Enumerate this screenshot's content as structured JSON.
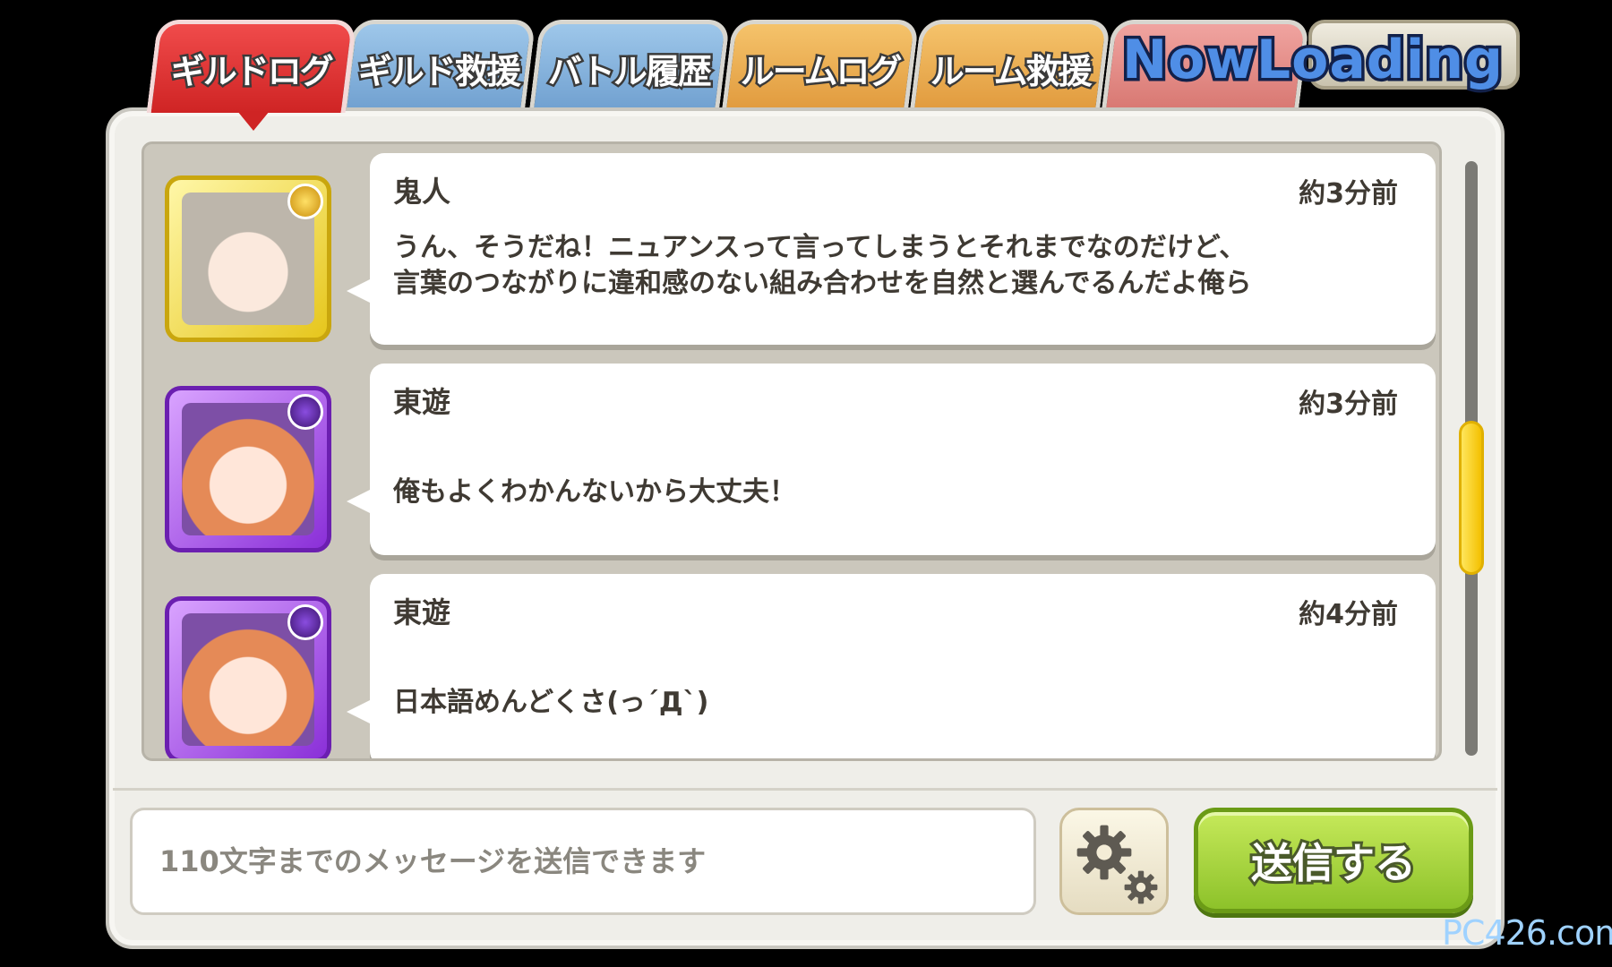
{
  "tabs": [
    {
      "label": "ギルドログ",
      "active": true,
      "color": "#e03535"
    },
    {
      "label": "ギルド救援",
      "active": false,
      "color": "#86b3de"
    },
    {
      "label": "バトル履歴",
      "active": false,
      "color": "#86b3de"
    },
    {
      "label": "ルームログ",
      "active": false,
      "color": "#efae55"
    },
    {
      "label": "ルーム救援",
      "active": false,
      "color": "#efae55"
    },
    {
      "label": "",
      "active": false,
      "color": "#e48f88"
    }
  ],
  "loading_text": "NowLoading",
  "messages": [
    {
      "name": "鬼人",
      "time": "約3分前",
      "text": "うん、そうだね！ニュアンスって言ってしまうとそれまでなのだけど、言葉のつながりに違和感のない組み合わせを自然と選んでるんだよ俺ら",
      "avatar_icon": "character-avatar-icon",
      "frame": "gold"
    },
    {
      "name": "東遊",
      "time": "約3分前",
      "text": "俺もよくわかんないから大丈夫！",
      "avatar_icon": "character-avatar-icon",
      "frame": "purple"
    },
    {
      "name": "東遊",
      "time": "約4分前",
      "text": "日本語めんどくさ(っ´Д`)",
      "avatar_icon": "character-avatar-icon",
      "frame": "purple"
    }
  ],
  "input": {
    "placeholder": "110文字までのメッセージを送信できます",
    "value": ""
  },
  "settings_icon": "gear-icon",
  "send_label": "送信する",
  "watermark": "PC426.com",
  "scroll_position": 0.45
}
